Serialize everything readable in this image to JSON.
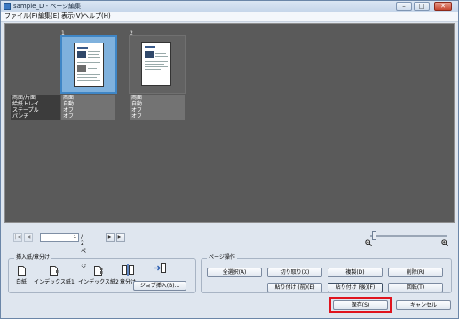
{
  "window": {
    "title": "sample_D - ページ編集",
    "min": "–",
    "max": "□",
    "close": "✕"
  },
  "menu": [
    "ファイル(F)",
    "編集(E)",
    "表示(V)",
    "ヘルプ(H)"
  ],
  "pages": [
    {
      "number": "1",
      "selected": true,
      "props": [
        [
          "両面/片面",
          "両面"
        ],
        [
          "給紙トレイ",
          "自動"
        ],
        [
          "ステープル",
          "オフ"
        ],
        [
          "パンチ",
          "オフ"
        ]
      ]
    },
    {
      "number": "2",
      "selected": false,
      "props": [
        [
          "両面",
          ""
        ],
        [
          "自動",
          ""
        ],
        [
          "オフ",
          ""
        ],
        [
          "オフ",
          ""
        ]
      ]
    }
  ],
  "navigation": {
    "current_page": "1",
    "total": "/ 2ページ"
  },
  "insert_group": {
    "title": "挿入紙/章分け",
    "items": [
      "白紙",
      "インデックス紙1",
      "インデックス紙2",
      "章分け"
    ],
    "job_insert": "ジョブ挿入(B)..."
  },
  "page_ops": {
    "title": "ページ操作",
    "row1": [
      "全選択(A)",
      "切り取り(X)",
      "複製(D)",
      "削除(R)"
    ],
    "row2": [
      "貼り付け (前)(E)",
      "貼り付け (後)(F)",
      "回転(T)"
    ]
  },
  "footer": {
    "save": "保存(S)",
    "cancel": "キャンセル"
  }
}
